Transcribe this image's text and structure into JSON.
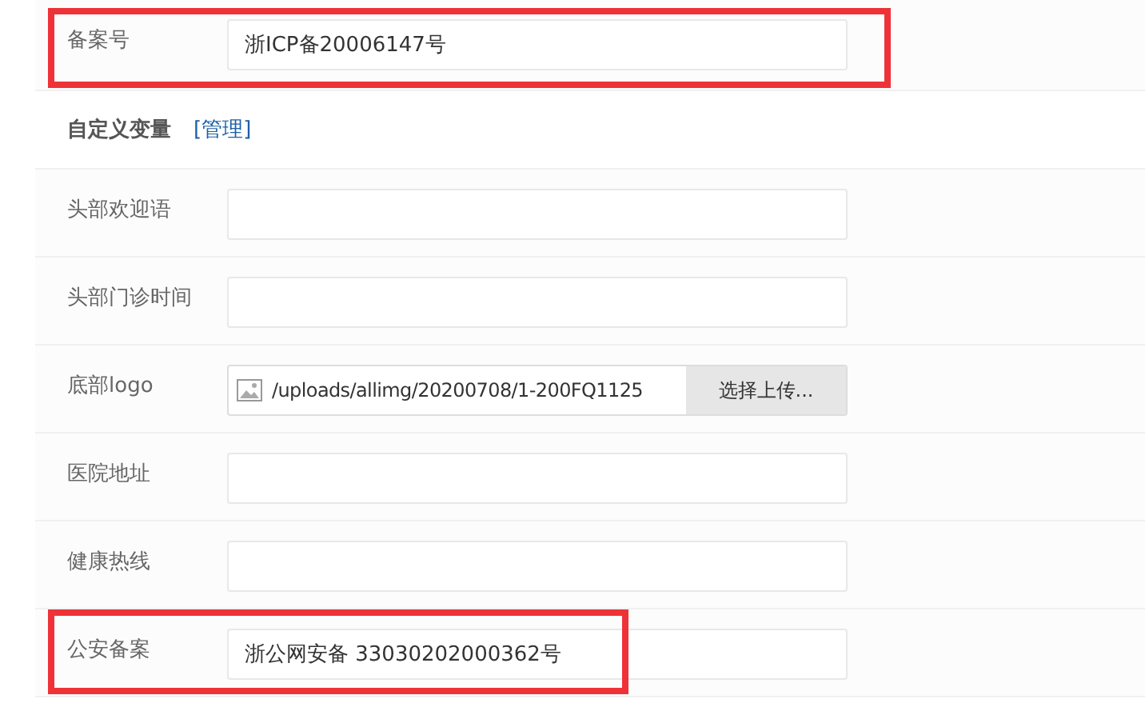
{
  "rows_top": [
    {
      "kind": "text",
      "label": "备案号",
      "value": "浙ICP备20006147号",
      "highlighted": true
    }
  ],
  "section": {
    "title": "自定义变量",
    "link": "[管理]"
  },
  "rows": [
    {
      "kind": "text",
      "label": "头部欢迎语",
      "highlighted": false
    },
    {
      "kind": "text",
      "label": "头部门诊时间",
      "highlighted": false
    },
    {
      "kind": "file",
      "label": "底部logo",
      "value": "/uploads/allimg/20200708/1-200FQ1125",
      "button": "选择上传...",
      "highlighted": false
    },
    {
      "kind": "text",
      "label": "医院地址",
      "highlighted": false
    },
    {
      "kind": "text",
      "label": "健康热线",
      "highlighted": false
    },
    {
      "kind": "text",
      "label": "公安备案",
      "value": "浙公网安备 33030202000362号",
      "highlighted": true
    }
  ]
}
